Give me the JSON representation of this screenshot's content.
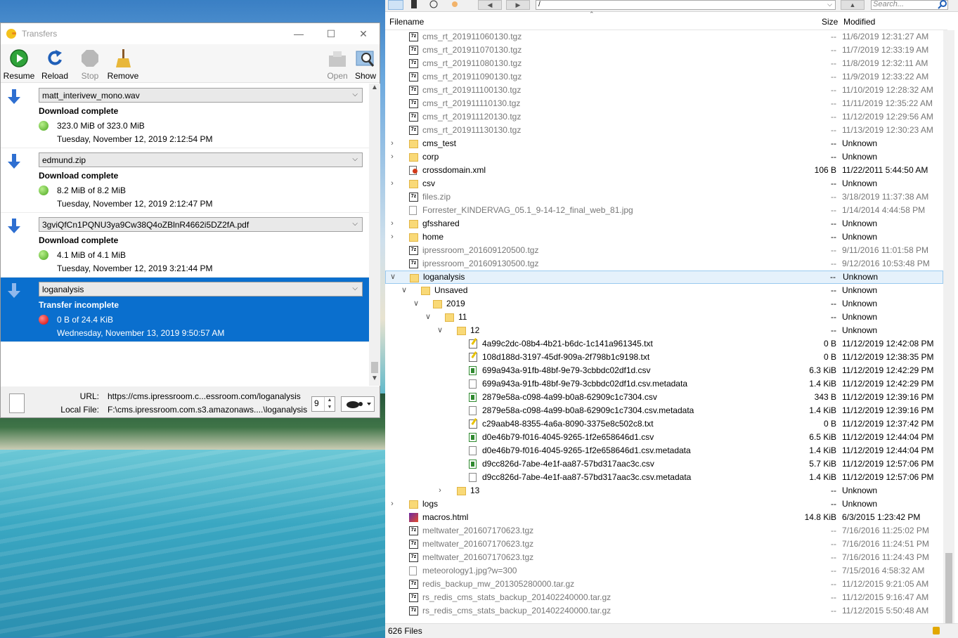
{
  "transfers": {
    "title": "Transfers",
    "toolbar": {
      "resume": "Resume",
      "reload": "Reload",
      "stop": "Stop",
      "remove": "Remove",
      "open": "Open",
      "show": "Show"
    },
    "items": [
      {
        "file": "matt_interivew_mono.wav",
        "status": "Download complete",
        "size": "323.0 MiB of 323.0 MiB",
        "date": "Tuesday, November 12, 2019 2:12:54 PM"
      },
      {
        "file": "edmund.zip",
        "status": "Download complete",
        "size": "8.2 MiB of 8.2 MiB",
        "date": "Tuesday, November 12, 2019 2:12:47 PM"
      },
      {
        "file": "3gviQfCn1PQNU3ya9Cw38Q4oZBlnR4662i5DZ2fA.pdf",
        "status": "Download complete",
        "size": "4.1 MiB of 4.1 MiB",
        "date": "Tuesday, November 12, 2019 3:21:44 PM"
      },
      {
        "file": "loganalysis",
        "status": "Transfer incomplete",
        "size": "0 B of 24.4 KiB",
        "date": "Wednesday, November 13, 2019 9:50:57 AM"
      }
    ],
    "footer": {
      "url_label": "URL:",
      "url_value": "https://cms.ipressroom.c...essroom.com/loganalysis",
      "local_label": "Local File:",
      "local_value": "F:\\cms.ipressroom.com.s3.amazonaws....\\loganalysis",
      "connections": "9"
    }
  },
  "browser": {
    "path": "/",
    "search_placeholder": "Search...",
    "columns": {
      "filename": "Filename",
      "size": "Size",
      "modified": "Modified"
    },
    "rows": [
      {
        "name": "cms_rt_201911060130.tgz",
        "size": "--",
        "mod": "11/6/2019 12:31:27 AM",
        "icon": "tgz-icon",
        "level": 0,
        "grey": true
      },
      {
        "name": "cms_rt_201911070130.tgz",
        "size": "--",
        "mod": "11/7/2019 12:33:19 AM",
        "icon": "tgz-icon",
        "level": 0,
        "grey": true
      },
      {
        "name": "cms_rt_201911080130.tgz",
        "size": "--",
        "mod": "11/8/2019 12:32:11 AM",
        "icon": "tgz-icon",
        "level": 0,
        "grey": true
      },
      {
        "name": "cms_rt_201911090130.tgz",
        "size": "--",
        "mod": "11/9/2019 12:33:22 AM",
        "icon": "tgz-icon",
        "level": 0,
        "grey": true
      },
      {
        "name": "cms_rt_201911100130.tgz",
        "size": "--",
        "mod": "11/10/2019 12:28:32 AM",
        "icon": "tgz-icon",
        "level": 0,
        "grey": true
      },
      {
        "name": "cms_rt_201911110130.tgz",
        "size": "--",
        "mod": "11/11/2019 12:35:22 AM",
        "icon": "tgz-icon",
        "level": 0,
        "grey": true
      },
      {
        "name": "cms_rt_201911120130.tgz",
        "size": "--",
        "mod": "11/12/2019 12:29:56 AM",
        "icon": "tgz-icon",
        "level": 0,
        "grey": true
      },
      {
        "name": "cms_rt_201911130130.tgz",
        "size": "--",
        "mod": "11/13/2019 12:30:23 AM",
        "icon": "tgz-icon",
        "level": 0,
        "grey": true
      },
      {
        "name": "cms_test",
        "size": "--",
        "mod": "Unknown",
        "icon": "folder-icon",
        "level": 0,
        "twisty": ">"
      },
      {
        "name": "corp",
        "size": "--",
        "mod": "Unknown",
        "icon": "folder-icon",
        "level": 0,
        "twisty": ">"
      },
      {
        "name": "crossdomain.xml",
        "size": "106 B",
        "mod": "11/22/2011 5:44:50 AM",
        "icon": "xml-icon",
        "level": 0
      },
      {
        "name": "csv",
        "size": "--",
        "mod": "Unknown",
        "icon": "folder-icon",
        "level": 0,
        "twisty": ">"
      },
      {
        "name": "files.zip",
        "size": "--",
        "mod": "3/18/2019 11:37:38 AM",
        "icon": "tgz-icon",
        "level": 0,
        "grey": true
      },
      {
        "name": "Forrester_KINDERVAG_05.1_9-14-12_final_web_81.jpg",
        "size": "--",
        "mod": "1/14/2014 4:44:58 PM",
        "icon": "image-icon",
        "level": 0,
        "grey": true
      },
      {
        "name": "gfsshared",
        "size": "--",
        "mod": "Unknown",
        "icon": "folder-icon",
        "level": 0,
        "twisty": ">"
      },
      {
        "name": "home",
        "size": "--",
        "mod": "Unknown",
        "icon": "folder-icon",
        "level": 0,
        "twisty": ">"
      },
      {
        "name": "ipressroom_201609120500.tgz",
        "size": "--",
        "mod": "9/11/2016 11:01:58 PM",
        "icon": "tgz-icon",
        "level": 0,
        "grey": true
      },
      {
        "name": "ipressroom_201609130500.tgz",
        "size": "--",
        "mod": "9/12/2016 10:53:48 PM",
        "icon": "tgz-icon",
        "level": 0,
        "grey": true
      },
      {
        "name": "loganalysis",
        "size": "--",
        "mod": "Unknown",
        "icon": "folder-icon",
        "level": 0,
        "twisty": "v",
        "selected": true
      },
      {
        "name": "Unsaved",
        "size": "--",
        "mod": "Unknown",
        "icon": "folder-icon",
        "level": 1,
        "twisty": "v"
      },
      {
        "name": "2019",
        "size": "--",
        "mod": "Unknown",
        "icon": "folder-icon",
        "level": 2,
        "twisty": "v"
      },
      {
        "name": "11",
        "size": "--",
        "mod": "Unknown",
        "icon": "folder-icon",
        "level": 3,
        "twisty": "v"
      },
      {
        "name": "12",
        "size": "--",
        "mod": "Unknown",
        "icon": "folder-icon",
        "level": 4,
        "twisty": "v"
      },
      {
        "name": "4a99c2dc-08b4-4b21-b6dc-1c141a961345.txt",
        "size": "0 B",
        "mod": "11/12/2019 12:42:08 PM",
        "icon": "text-file-icon",
        "level": 5
      },
      {
        "name": "108d188d-3197-45df-909a-2f798b1c9198.txt",
        "size": "0 B",
        "mod": "11/12/2019 12:38:35 PM",
        "icon": "text-file-icon",
        "level": 5
      },
      {
        "name": "699a943a-91fb-48bf-9e79-3cbbdc02df1d.csv",
        "size": "6.3 KiB",
        "mod": "11/12/2019 12:42:29 PM",
        "icon": "csv-icon",
        "level": 5
      },
      {
        "name": "699a943a-91fb-48bf-9e79-3cbbdc02df1d.csv.metadata",
        "size": "1.4 KiB",
        "mod": "11/12/2019 12:42:29 PM",
        "icon": "file-icon",
        "level": 5
      },
      {
        "name": "2879e58a-c098-4a99-b0a8-62909c1c7304.csv",
        "size": "343 B",
        "mod": "11/12/2019 12:39:16 PM",
        "icon": "csv-icon",
        "level": 5
      },
      {
        "name": "2879e58a-c098-4a99-b0a8-62909c1c7304.csv.metadata",
        "size": "1.4 KiB",
        "mod": "11/12/2019 12:39:16 PM",
        "icon": "file-icon",
        "level": 5
      },
      {
        "name": "c29aab48-8355-4a6a-8090-3375e8c502c8.txt",
        "size": "0 B",
        "mod": "11/12/2019 12:37:42 PM",
        "icon": "text-file-icon",
        "level": 5
      },
      {
        "name": "d0e46b79-f016-4045-9265-1f2e658646d1.csv",
        "size": "6.5 KiB",
        "mod": "11/12/2019 12:44:04 PM",
        "icon": "csv-icon",
        "level": 5
      },
      {
        "name": "d0e46b79-f016-4045-9265-1f2e658646d1.csv.metadata",
        "size": "1.4 KiB",
        "mod": "11/12/2019 12:44:04 PM",
        "icon": "file-icon",
        "level": 5
      },
      {
        "name": "d9cc826d-7abe-4e1f-aa87-57bd317aac3c.csv",
        "size": "5.7 KiB",
        "mod": "11/12/2019 12:57:06 PM",
        "icon": "csv-icon",
        "level": 5
      },
      {
        "name": "d9cc826d-7abe-4e1f-aa87-57bd317aac3c.csv.metadata",
        "size": "1.4 KiB",
        "mod": "11/12/2019 12:57:06 PM",
        "icon": "file-icon",
        "level": 5
      },
      {
        "name": "13",
        "size": "--",
        "mod": "Unknown",
        "icon": "folder-icon",
        "level": 4,
        "twisty": ">"
      },
      {
        "name": "logs",
        "size": "--",
        "mod": "Unknown",
        "icon": "folder-icon",
        "level": 0,
        "twisty": ">"
      },
      {
        "name": "macros.html",
        "size": "14.8 KiB",
        "mod": "6/3/2015 1:23:42 PM",
        "icon": "html-icon",
        "level": 0
      },
      {
        "name": "meltwater_201607170623.tgz",
        "size": "--",
        "mod": "7/16/2016 11:25:02 PM",
        "icon": "tgz-icon",
        "level": 0,
        "grey": true
      },
      {
        "name": "meltwater_201607170623.tgz",
        "size": "--",
        "mod": "7/16/2016 11:24:51 PM",
        "icon": "tgz-icon",
        "level": 0,
        "grey": true
      },
      {
        "name": "meltwater_201607170623.tgz",
        "size": "--",
        "mod": "7/16/2016 11:24:43 PM",
        "icon": "tgz-icon",
        "level": 0,
        "grey": true
      },
      {
        "name": "meteorology1.jpg?w=300",
        "size": "--",
        "mod": "7/15/2016 4:58:32 AM",
        "icon": "image-icon",
        "level": 0,
        "grey": true
      },
      {
        "name": "redis_backup_mw_201305280000.tar.gz",
        "size": "--",
        "mod": "11/12/2015 9:21:05 AM",
        "icon": "tgz-icon",
        "level": 0,
        "grey": true
      },
      {
        "name": "rs_redis_cms_stats_backup_201402240000.tar.gz",
        "size": "--",
        "mod": "11/12/2015 9:16:47 AM",
        "icon": "tgz-icon",
        "level": 0,
        "grey": true
      },
      {
        "name": "rs_redis_cms_stats_backup_201402240000.tar.gz",
        "size": "--",
        "mod": "11/12/2015 5:50:48 AM",
        "icon": "tgz-icon",
        "level": 0,
        "grey": true
      }
    ],
    "status": "626 Files"
  }
}
